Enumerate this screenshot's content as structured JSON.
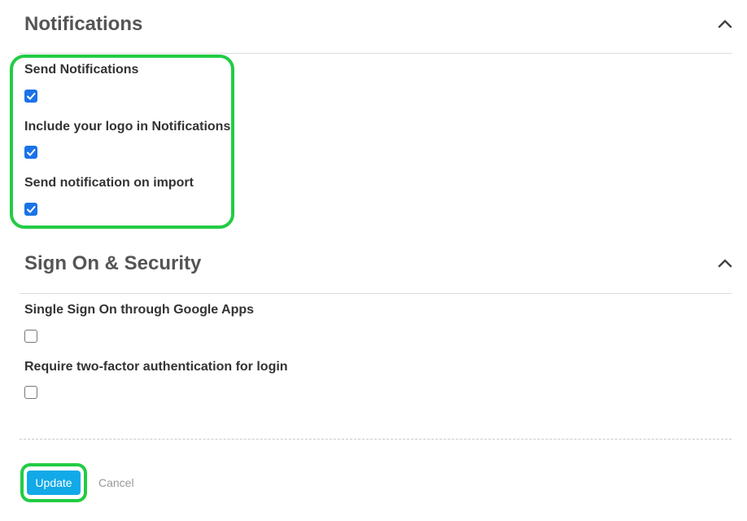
{
  "notifications": {
    "title": "Notifications",
    "collapse_icon": "chevron-up-icon",
    "items": [
      {
        "label": "Send Notifications",
        "checked": true
      },
      {
        "label": "Include your logo in Notifications",
        "checked": true
      },
      {
        "label": "Send notification on import",
        "checked": true
      }
    ]
  },
  "security": {
    "title": "Sign On & Security",
    "collapse_icon": "chevron-up-icon",
    "items": [
      {
        "label": "Single Sign On through Google Apps",
        "checked": false
      },
      {
        "label": "Require two-factor authentication for login",
        "checked": false
      }
    ]
  },
  "actions": {
    "update_label": "Update",
    "cancel_label": "Cancel"
  },
  "colors": {
    "checkbox_checked": "#1a73e8",
    "primary_button": "#12a9e8",
    "highlight": "#22cc44"
  }
}
